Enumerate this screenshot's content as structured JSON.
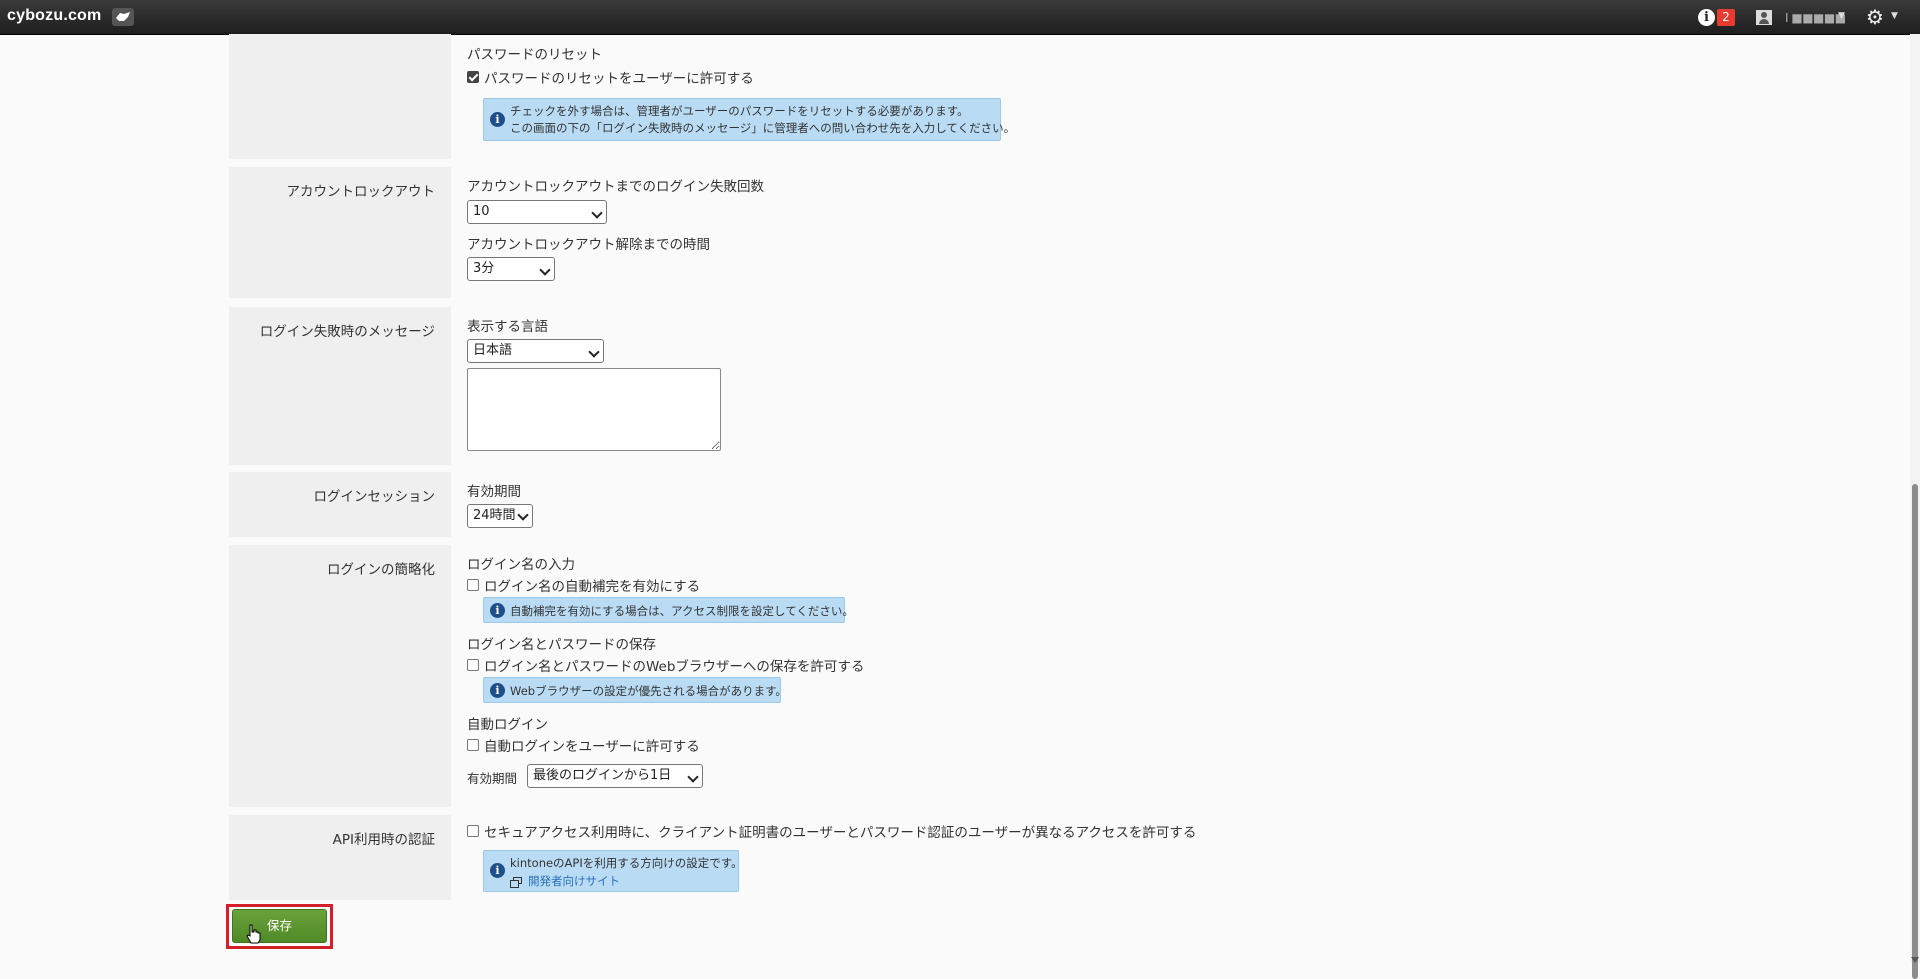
{
  "topbar": {
    "logo": "cybozu.com",
    "notification_count": "2",
    "user_name": "I ■■■■■"
  },
  "password_reset": {
    "heading": "パスワードのリセット",
    "checkbox_label": "パスワードのリセットをユーザーに許可する",
    "checked": true,
    "info_line1": "チェックを外す場合は、管理者がユーザーのパスワードをリセットする必要があります。",
    "info_line2": "この画面の下の「ログイン失敗時のメッセージ」に管理者への問い合わせ先を入力してください。"
  },
  "account_lockout": {
    "label": "アカウントロックアウト",
    "attempts_heading": "アカウントロックアウトまでのログイン失敗回数",
    "attempts_value": "10",
    "unlock_heading": "アカウントロックアウト解除までの時間",
    "unlock_value": "3分"
  },
  "login_failure_message": {
    "label": "ログイン失敗時のメッセージ",
    "language_heading": "表示する言語",
    "language_value": "日本語",
    "message_text": ""
  },
  "login_session": {
    "label": "ログインセッション",
    "period_heading": "有効期間",
    "period_value": "24時間"
  },
  "login_simplify": {
    "label": "ログインの簡略化",
    "name_input_heading": "ログイン名の入力",
    "autocomplete_label": "ログイン名の自動補完を有効にする",
    "autocomplete_info": "自動補完を有効にする場合は、アクセス制限を設定してください。",
    "save_heading": "ログイン名とパスワードの保存",
    "save_label": "ログイン名とパスワードのWebブラウザーへの保存を許可する",
    "save_info": "Webブラウザーの設定が優先される場合があります。",
    "auto_login_heading": "自動ログイン",
    "auto_login_label": "自動ログインをユーザーに許可する",
    "auto_login_period_label": "有効期間",
    "auto_login_period_value": "最後のログインから1日"
  },
  "api_auth": {
    "label": "API利用時の認証",
    "checkbox_label": "セキュアアクセス利用時に、クライアント証明書のユーザーとパスワード認証のユーザーが異なるアクセスを許可する",
    "info_line1": "kintoneのAPIを利用する方向けの設定です。",
    "dev_link": "開発者向けサイト"
  },
  "save_button": "保存"
}
